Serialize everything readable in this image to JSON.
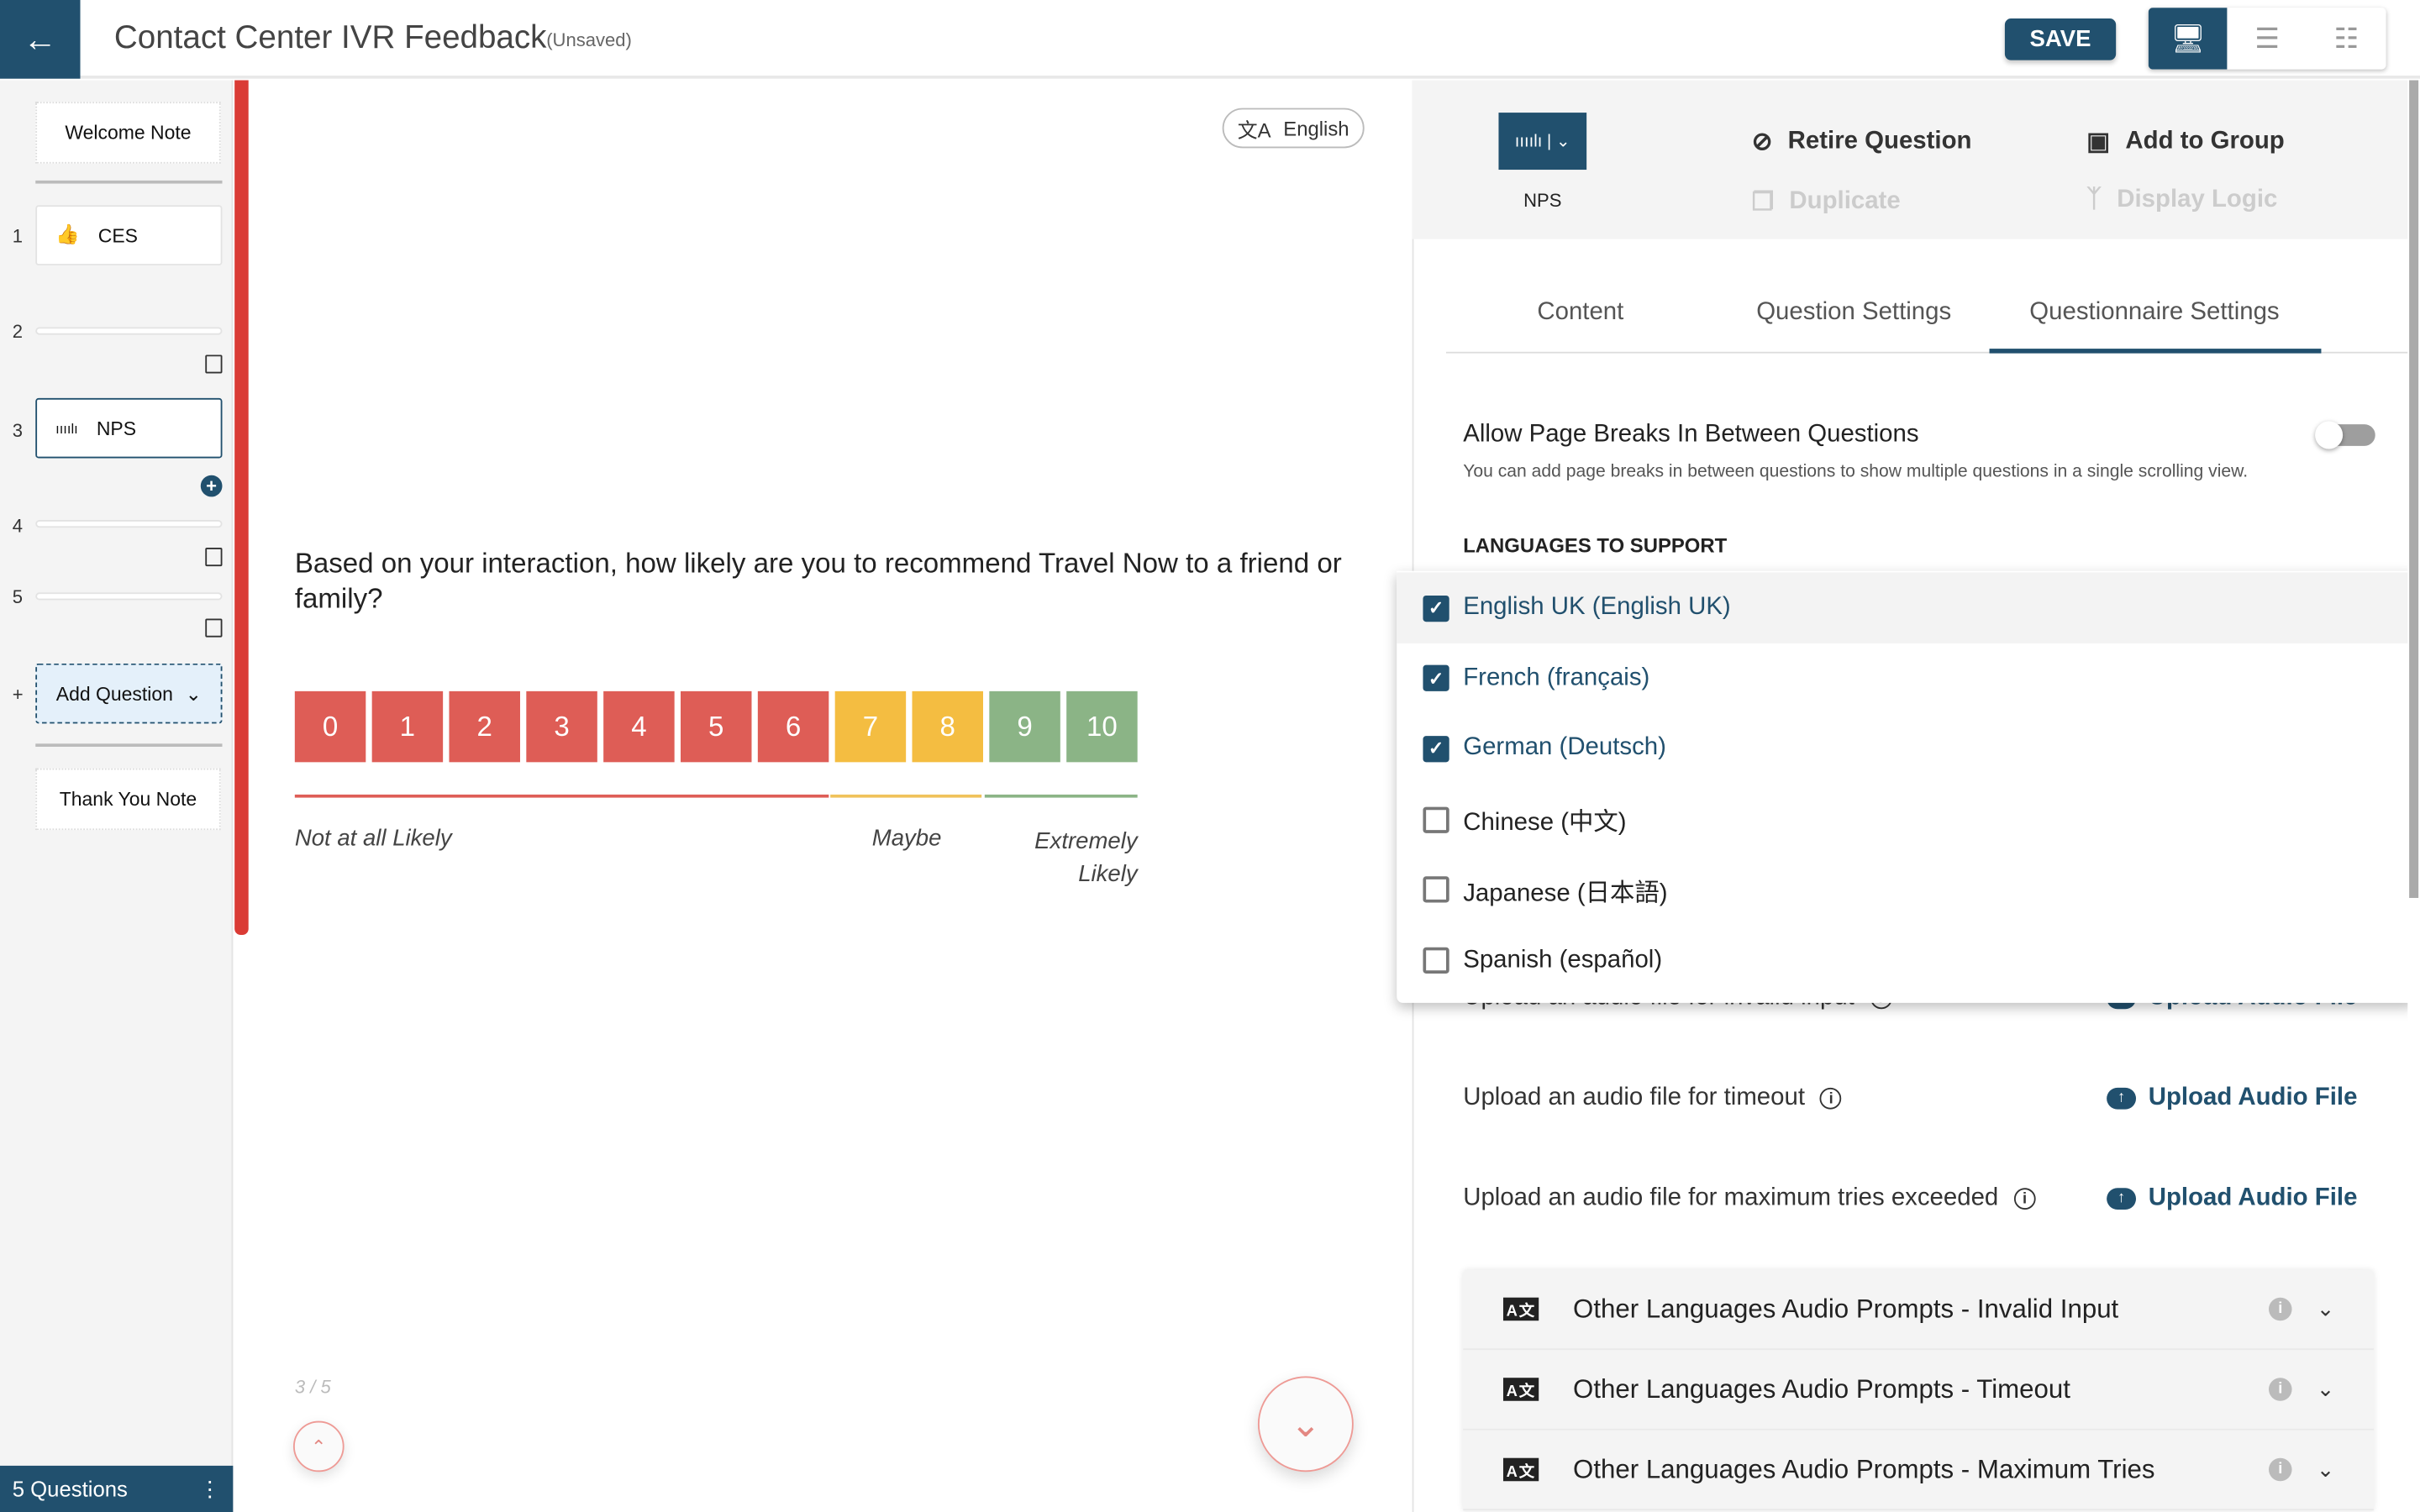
{
  "header": {
    "title": "Contact Center IVR Feedback",
    "status": "(Unsaved)",
    "save_label": "SAVE",
    "back_icon": "arrow-left-icon",
    "views": [
      "desktop-view",
      "list-view",
      "tree-view"
    ]
  },
  "sidebar": {
    "welcome": "Welcome Note",
    "thank_you": "Thank You Note",
    "questions": [
      {
        "num": "1",
        "label": "CES",
        "icon": "thumbs-up-icon"
      },
      {
        "num": "2",
        "label": ""
      },
      {
        "num": "3",
        "label": "NPS",
        "icon": "nps-icon",
        "selected": true
      },
      {
        "num": "4",
        "label": ""
      },
      {
        "num": "5",
        "label": ""
      }
    ],
    "add_prefix": "+",
    "add_question": "Add Question",
    "footer": "5 Questions"
  },
  "canvas": {
    "language": "English",
    "question": "Based on your interaction, how likely are you to recommend Travel Now to a friend or family?",
    "scale": [
      "0",
      "1",
      "2",
      "3",
      "4",
      "5",
      "6",
      "7",
      "8",
      "9",
      "10"
    ],
    "colors": {
      "detractor": "#de5d56",
      "passive": "#f4bd41",
      "promoter": "#8bb486"
    },
    "label_low": "Not at all Likely",
    "label_mid": "Maybe",
    "label_high": "Extremely Likely",
    "counter": "3 / 5"
  },
  "panel": {
    "type": "NPS",
    "actions": {
      "retire": "Retire Question",
      "add_group": "Add to Group",
      "duplicate": "Duplicate",
      "display_logic": "Display Logic"
    },
    "tabs": [
      "Content",
      "Question Settings",
      "Questionnaire Settings"
    ],
    "active_tab": "Questionnaire Settings",
    "page_breaks": {
      "title": "Allow Page Breaks In Between Questions",
      "desc": "You can add page breaks in between questions to show multiple questions in a single scrolling view.",
      "enabled": false
    },
    "languages_heading": "LANGUAGES TO SUPPORT",
    "languages": [
      {
        "label": "English UK (English UK)",
        "checked": true
      },
      {
        "label": "French (français)",
        "checked": true
      },
      {
        "label": "German (Deutsch)",
        "checked": true
      },
      {
        "label": "Chinese (中文)",
        "checked": false
      },
      {
        "label": "Japanese (日本語)",
        "checked": false
      },
      {
        "label": "Spanish (español)",
        "checked": false
      }
    ],
    "uploads": [
      {
        "label": "Upload an audio file for invalid input",
        "action": "Upload Audio File"
      },
      {
        "label": "Upload an audio file for timeout",
        "action": "Upload Audio File"
      },
      {
        "label": "Upload an audio file for maximum tries exceeded",
        "action": "Upload Audio File"
      }
    ],
    "accordions": [
      "Other Languages Audio Prompts - Invalid Input",
      "Other Languages Audio Prompts - Timeout",
      "Other Languages Audio Prompts - Maximum Tries"
    ],
    "accent": "#21506e"
  }
}
